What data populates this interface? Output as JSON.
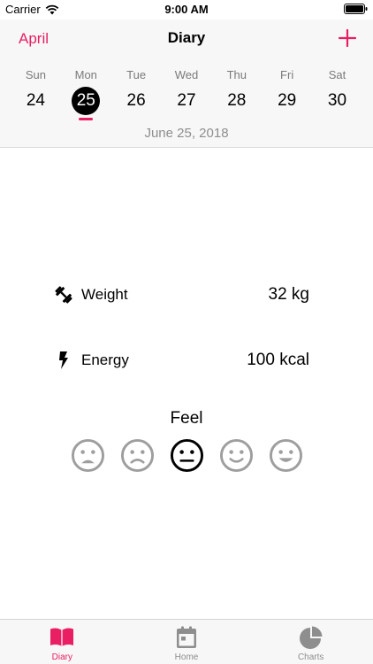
{
  "status_bar": {
    "carrier": "Carrier",
    "time": "9:00 AM"
  },
  "nav": {
    "month": "April",
    "title": "Diary",
    "add_icon": "plus-icon"
  },
  "week": [
    {
      "name": "Sun",
      "num": "24",
      "selected": false
    },
    {
      "name": "Mon",
      "num": "25",
      "selected": true
    },
    {
      "name": "Tue",
      "num": "26",
      "selected": false
    },
    {
      "name": "Wed",
      "num": "27",
      "selected": false
    },
    {
      "name": "Thu",
      "num": "28",
      "selected": false
    },
    {
      "name": "Fri",
      "num": "29",
      "selected": false
    },
    {
      "name": "Sat",
      "num": "30",
      "selected": false
    }
  ],
  "selected_date": "June 25, 2018",
  "metrics": {
    "weight": {
      "label": "Weight",
      "value": "32 kg",
      "icon": "dumbbell-icon"
    },
    "energy": {
      "label": "Energy",
      "value": "100 kcal",
      "icon": "lightning-icon"
    }
  },
  "feel": {
    "label": "Feel",
    "faces": [
      "very-sad",
      "sad",
      "neutral",
      "happy",
      "very-happy"
    ],
    "selected": "neutral"
  },
  "tabs": [
    {
      "label": "Diary",
      "icon": "book-icon",
      "active": true
    },
    {
      "label": "Home",
      "icon": "calendar-icon",
      "active": false
    },
    {
      "label": "Charts",
      "icon": "pie-chart-icon",
      "active": false
    }
  ],
  "colors": {
    "accent": "#e91e63",
    "inactive": "#8e8e8e",
    "face_inactive": "#9e9e9e"
  }
}
